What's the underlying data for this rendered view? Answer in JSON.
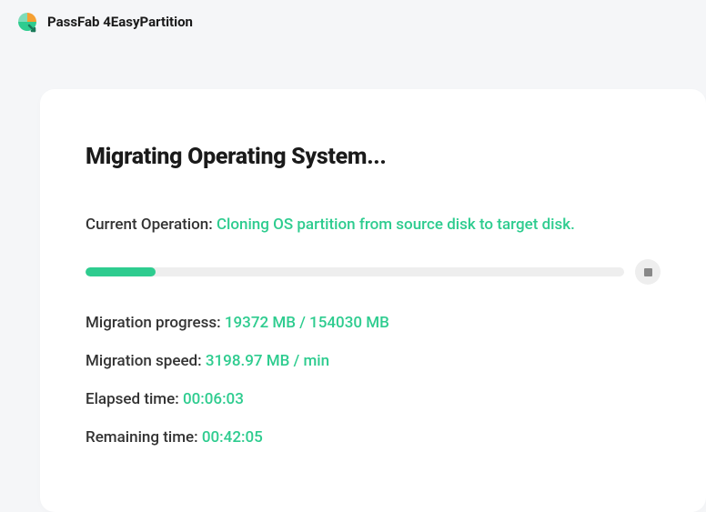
{
  "header": {
    "app_title": "PassFab 4EasyPartition"
  },
  "main": {
    "title": "Migrating Operating System...",
    "operation": {
      "label": "Current Operation: ",
      "value": "Cloning OS partition from source disk to target disk."
    },
    "progress": {
      "percent": 13,
      "label": "Migration progress: ",
      "value": "19372 MB / 154030 MB"
    },
    "speed": {
      "label": "Migration speed: ",
      "value": "3198.97 MB / min"
    },
    "elapsed": {
      "label": "Elapsed time: ",
      "value": "00:06:03"
    },
    "remaining": {
      "label": "Remaining time: ",
      "value": "00:42:05"
    }
  },
  "colors": {
    "accent": "#2ecc8f",
    "bg": "#f5f6f8",
    "card": "#ffffff"
  }
}
